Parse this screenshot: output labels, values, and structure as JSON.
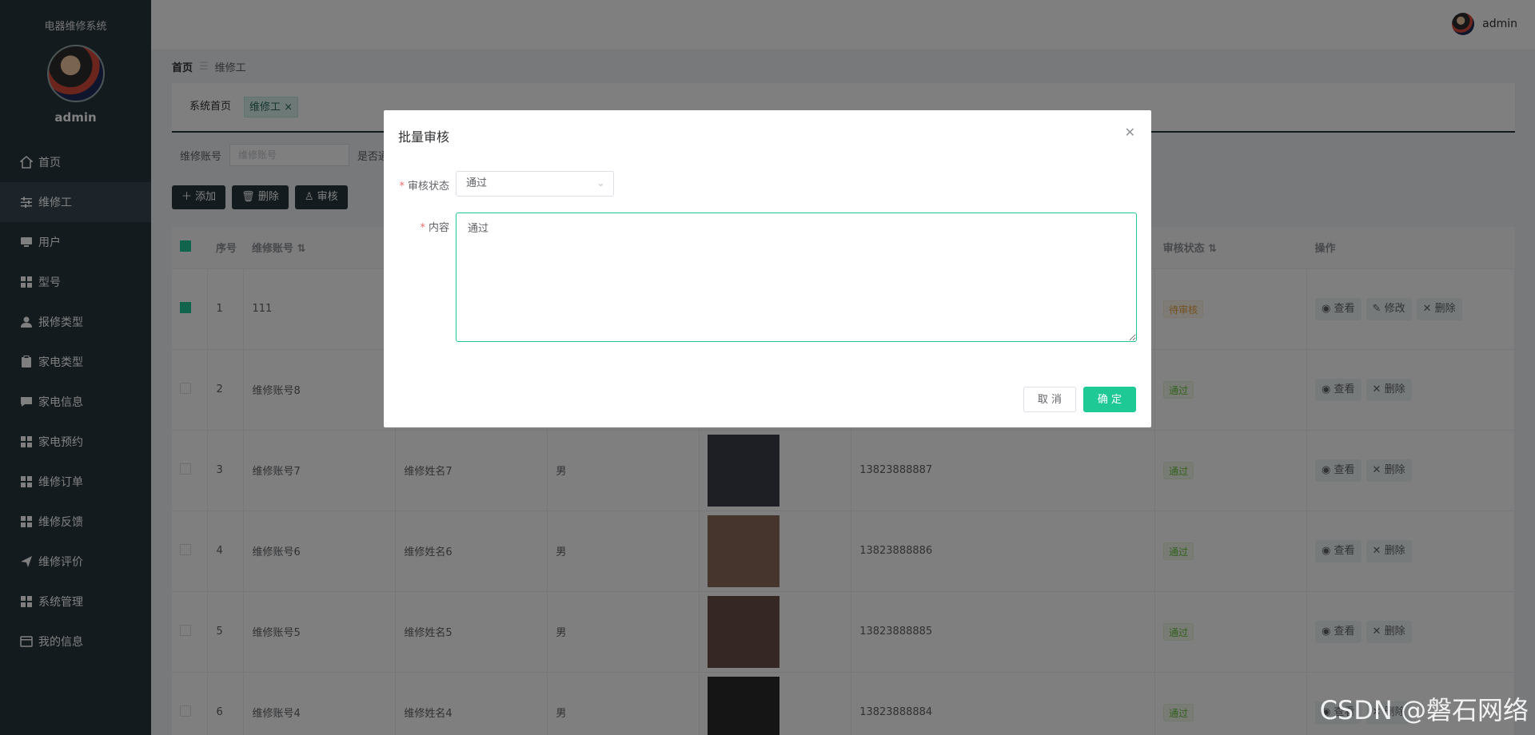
{
  "sidebar": {
    "system_title": "电器维修系统",
    "username": "admin",
    "items": [
      {
        "label": "首页",
        "icon": "home-icon",
        "active": false
      },
      {
        "label": "维修工",
        "icon": "sliders-icon",
        "active": true
      },
      {
        "label": "用户",
        "icon": "monitor-icon",
        "active": false
      },
      {
        "label": "型号",
        "icon": "grid-icon",
        "active": false
      },
      {
        "label": "报修类型",
        "icon": "user-icon",
        "active": false
      },
      {
        "label": "家电类型",
        "icon": "clipboard-icon",
        "active": false
      },
      {
        "label": "家电信息",
        "icon": "chat-icon",
        "active": false
      },
      {
        "label": "家电预约",
        "icon": "grid-icon",
        "active": false
      },
      {
        "label": "维修订单",
        "icon": "grid-icon",
        "active": false
      },
      {
        "label": "维修反馈",
        "icon": "grid-icon",
        "active": false
      },
      {
        "label": "维修评价",
        "icon": "send-icon",
        "active": false
      },
      {
        "label": "系统管理",
        "icon": "grid-icon",
        "active": false
      },
      {
        "label": "我的信息",
        "icon": "card-icon",
        "active": false
      }
    ]
  },
  "topbar": {
    "username": "admin"
  },
  "breadcrumb": {
    "home": "首页",
    "current": "维修工"
  },
  "tags": {
    "home": "系统首页",
    "current": "维修工"
  },
  "search": {
    "label": "维修账号",
    "placeholder": "维修账号",
    "label2": "是否通"
  },
  "toolbar": {
    "add": "添加",
    "delete": "删除",
    "audit": "审核"
  },
  "table": {
    "headers": {
      "index": "序号",
      "account": "维修账号",
      "audit_status": "审核状态",
      "actions": "操作"
    },
    "actions": {
      "view": "查看",
      "edit": "修改",
      "delete": "删除"
    },
    "rows": [
      {
        "index": "1",
        "account": "111",
        "name": "",
        "gender": "",
        "phone": "",
        "status": "待审核",
        "status_type": "wait",
        "checked": true,
        "has_edit": true,
        "thumb": ""
      },
      {
        "index": "2",
        "account": "维修账号8",
        "name": "",
        "gender": "",
        "phone": "",
        "status": "通过",
        "status_type": "pass",
        "checked": false,
        "has_edit": false,
        "thumb": ""
      },
      {
        "index": "3",
        "account": "维修账号7",
        "name": "维修姓名7",
        "gender": "男",
        "phone": "13823888887",
        "status": "通过",
        "status_type": "pass",
        "checked": false,
        "has_edit": false,
        "thumb": "#3a3f4a"
      },
      {
        "index": "4",
        "account": "维修账号6",
        "name": "维修姓名6",
        "gender": "男",
        "phone": "13823888886",
        "status": "通过",
        "status_type": "pass",
        "checked": false,
        "has_edit": false,
        "thumb": "#8a6a5a"
      },
      {
        "index": "5",
        "account": "维修账号5",
        "name": "维修姓名5",
        "gender": "男",
        "phone": "13823888885",
        "status": "通过",
        "status_type": "pass",
        "checked": false,
        "has_edit": false,
        "thumb": "#6a5048"
      },
      {
        "index": "6",
        "account": "维修账号4",
        "name": "维修姓名4",
        "gender": "男",
        "phone": "13823888884",
        "status": "通过",
        "status_type": "pass",
        "checked": false,
        "has_edit": false,
        "thumb": "#2a2a2a"
      }
    ]
  },
  "dialog": {
    "title": "批量审核",
    "status_label": "审核状态",
    "status_value": "通过",
    "content_label": "内容",
    "content_value": "通过",
    "cancel": "取 消",
    "ok": "确 定"
  },
  "watermark": "CSDN @磐石网络",
  "colors": {
    "sidebar": "#28363f",
    "accent": "#1fc996",
    "overlay": "rgba(0,0,0,0.5)"
  }
}
